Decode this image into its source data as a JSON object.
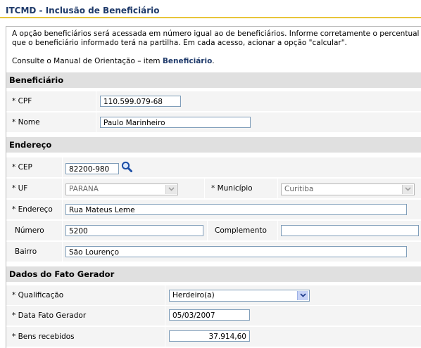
{
  "header": {
    "title": "ITCMD - Inclusão de Beneficiário"
  },
  "intro": {
    "text": "A opção beneficiários será acessada em número igual ao de beneficiários. Informe corretamente o percentual que o beneficiário informado terá na partilha. Em cada acesso, acionar a opção \"calcular\".",
    "manual_prefix": "Consulte o Manual de Orientação – item ",
    "manual_link": "Beneficiário",
    "manual_suffix": "."
  },
  "sections": {
    "beneficiario": "Beneficiário",
    "endereco": "Endereço",
    "fato_gerador": "Dados do Fato Gerador"
  },
  "beneficiario": {
    "cpf_label": "*  CPF",
    "cpf_value": "110.599.079-68",
    "nome_label": "*  Nome",
    "nome_value": "Paulo Marinheiro"
  },
  "endereco": {
    "cep_label": "* CEP",
    "cep_value": "82200-980",
    "uf_label": "* UF",
    "uf_value": "PARANA",
    "municipio_label": "* Município",
    "municipio_value": "Curitiba",
    "endereco_label": "* Endereço",
    "endereco_value": "Rua Mateus Leme",
    "numero_label": "Número",
    "numero_value": "5200",
    "complemento_label": "Complemento",
    "complemento_value": "",
    "bairro_label": "Bairro",
    "bairro_value": "São Lourenço"
  },
  "fato": {
    "qualificacao_label": "*  Qualificação",
    "qualificacao_value": "Herdeiro(a)",
    "data_label": "*  Data Fato Gerador",
    "data_value": "05/03/2007",
    "bens_label": "*  Bens recebidos",
    "bens_value": "37.914,60"
  },
  "icons": {
    "search": "search-icon",
    "dropdown": "chevron-down-icon"
  },
  "colors": {
    "title": "#1f3a6a",
    "title_rule": "#e8c53a",
    "section_bg": "#e0e0e0",
    "row_bg": "#f4f4f4"
  }
}
